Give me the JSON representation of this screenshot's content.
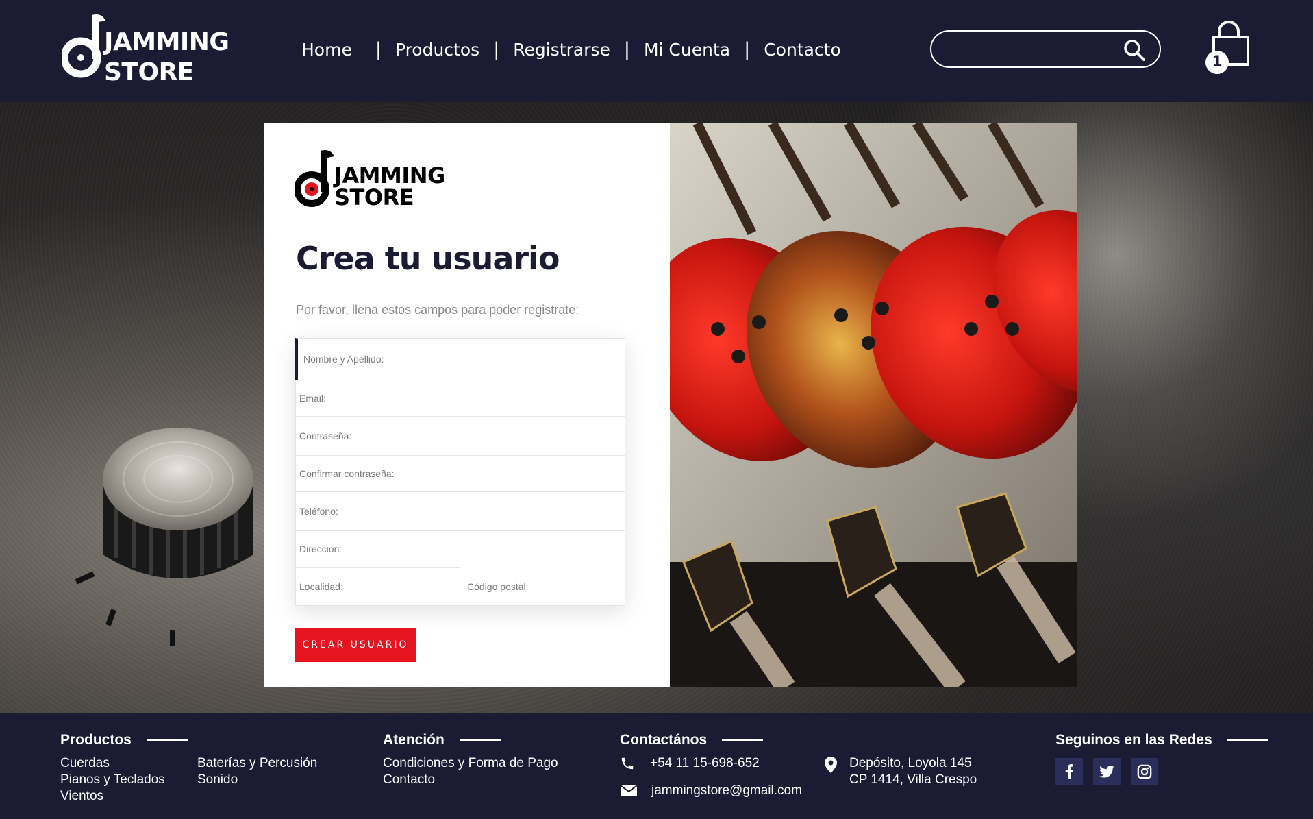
{
  "header": {
    "logo": {
      "line1": "JAMMING",
      "line2": "STORE"
    },
    "nav": [
      {
        "label": "Home"
      },
      {
        "label": "Productos"
      },
      {
        "label": "Registrarse"
      },
      {
        "label": "Mi Cuenta"
      },
      {
        "label": "Contacto"
      }
    ],
    "search": {
      "value": "",
      "placeholder": ""
    },
    "cart": {
      "count": "1"
    }
  },
  "card": {
    "logo": {
      "line1": "JAMMING",
      "line2": "STORE"
    },
    "title": "Crea tu usuario",
    "subtitle": "Por favor, llena estos campos para poder registrate:",
    "fields": {
      "name": "Nombre y Apellido:",
      "email": "Email:",
      "password": "Contraseña:",
      "confirm": "Confirmar contraseña:",
      "phone": "Teléfono:",
      "address": "Direccion:",
      "city": "Localidad:",
      "zip": "Código postal:"
    },
    "submit_label": "CREAR USUARIO"
  },
  "footer": {
    "productos": {
      "title": "Productos",
      "col1": [
        "Cuerdas",
        "Pianos y Teclados",
        "Vientos"
      ],
      "col2": [
        "Baterías y Percusión",
        "Sonido"
      ]
    },
    "atencion": {
      "title": "Atención",
      "links": [
        "Condiciones y Forma de Pago",
        "Contacto"
      ]
    },
    "contacto": {
      "title": "Contactános",
      "phone": "+54 11 15-698-652",
      "email": "jammingstore@gmail.com",
      "address1": "Depósito, Loyola 145",
      "address2": "CP 1414, Villa Crespo"
    },
    "redes": {
      "title": "Seguinos en las Redes",
      "icons": [
        "facebook-icon",
        "twitter-icon",
        "instagram-icon"
      ]
    }
  },
  "colors": {
    "navy": "#1c1b34",
    "accent_red": "#e5141e",
    "white": "#ffffff",
    "social_bg": "#2b2d5a"
  }
}
